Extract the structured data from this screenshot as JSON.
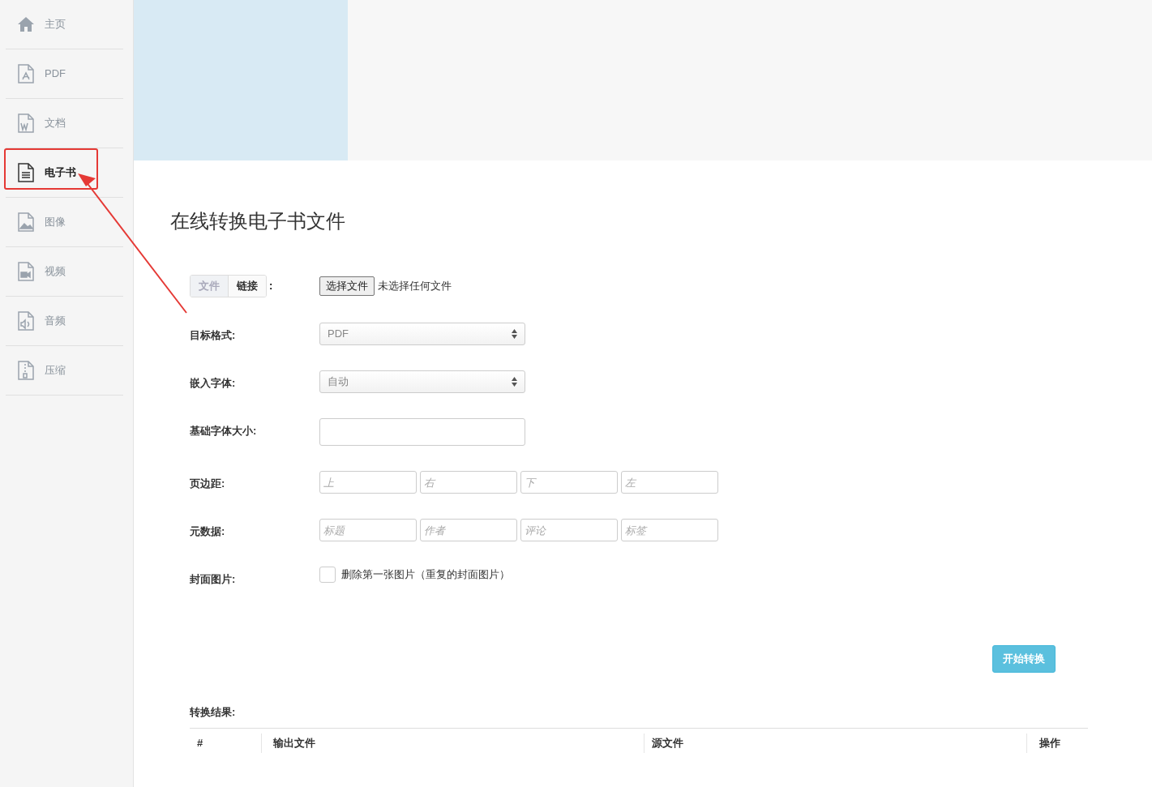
{
  "sidebar": {
    "items": [
      {
        "label": "主页",
        "kind": "home",
        "selected": false
      },
      {
        "label": "PDF",
        "kind": "pdf",
        "selected": false
      },
      {
        "label": "文档",
        "kind": "word",
        "selected": false
      },
      {
        "label": "电子书",
        "kind": "ebook",
        "selected": true
      },
      {
        "label": "图像",
        "kind": "image",
        "selected": false
      },
      {
        "label": "视频",
        "kind": "video",
        "selected": false
      },
      {
        "label": "音频",
        "kind": "audio",
        "selected": false
      },
      {
        "label": "压缩",
        "kind": "zip",
        "selected": false
      }
    ]
  },
  "annotation": {
    "kind": "highlight-arrow"
  },
  "form": {
    "title": "在线转换电子书文件",
    "source_tabs": [
      {
        "label": "文件",
        "selected": false
      },
      {
        "label": "链接",
        "selected": true
      }
    ],
    "source_colon": ":",
    "file_button": "选择文件",
    "file_status": "未选择任何文件",
    "rows": [
      {
        "kind": "select",
        "label": "目标格式:",
        "value": "PDF"
      },
      {
        "kind": "select",
        "label": "嵌入字体:",
        "value": "自动"
      },
      {
        "kind": "text",
        "label": "基础字体大小:"
      },
      {
        "kind": "quad",
        "label": "页边距:",
        "placeholders": [
          "上",
          "右",
          "下",
          "左"
        ]
      },
      {
        "kind": "quad",
        "label": "元数据:",
        "placeholders": [
          "标题",
          "作者",
          "评论",
          "标签"
        ]
      },
      {
        "kind": "checkbox",
        "label": "封面图片:",
        "text": "删除第一张图片（重复的封面图片）",
        "checked": false
      }
    ],
    "submit": "开始转换",
    "results_label": "转换结果:",
    "columns": [
      "#",
      "输出文件",
      "源文件",
      "操作"
    ]
  }
}
